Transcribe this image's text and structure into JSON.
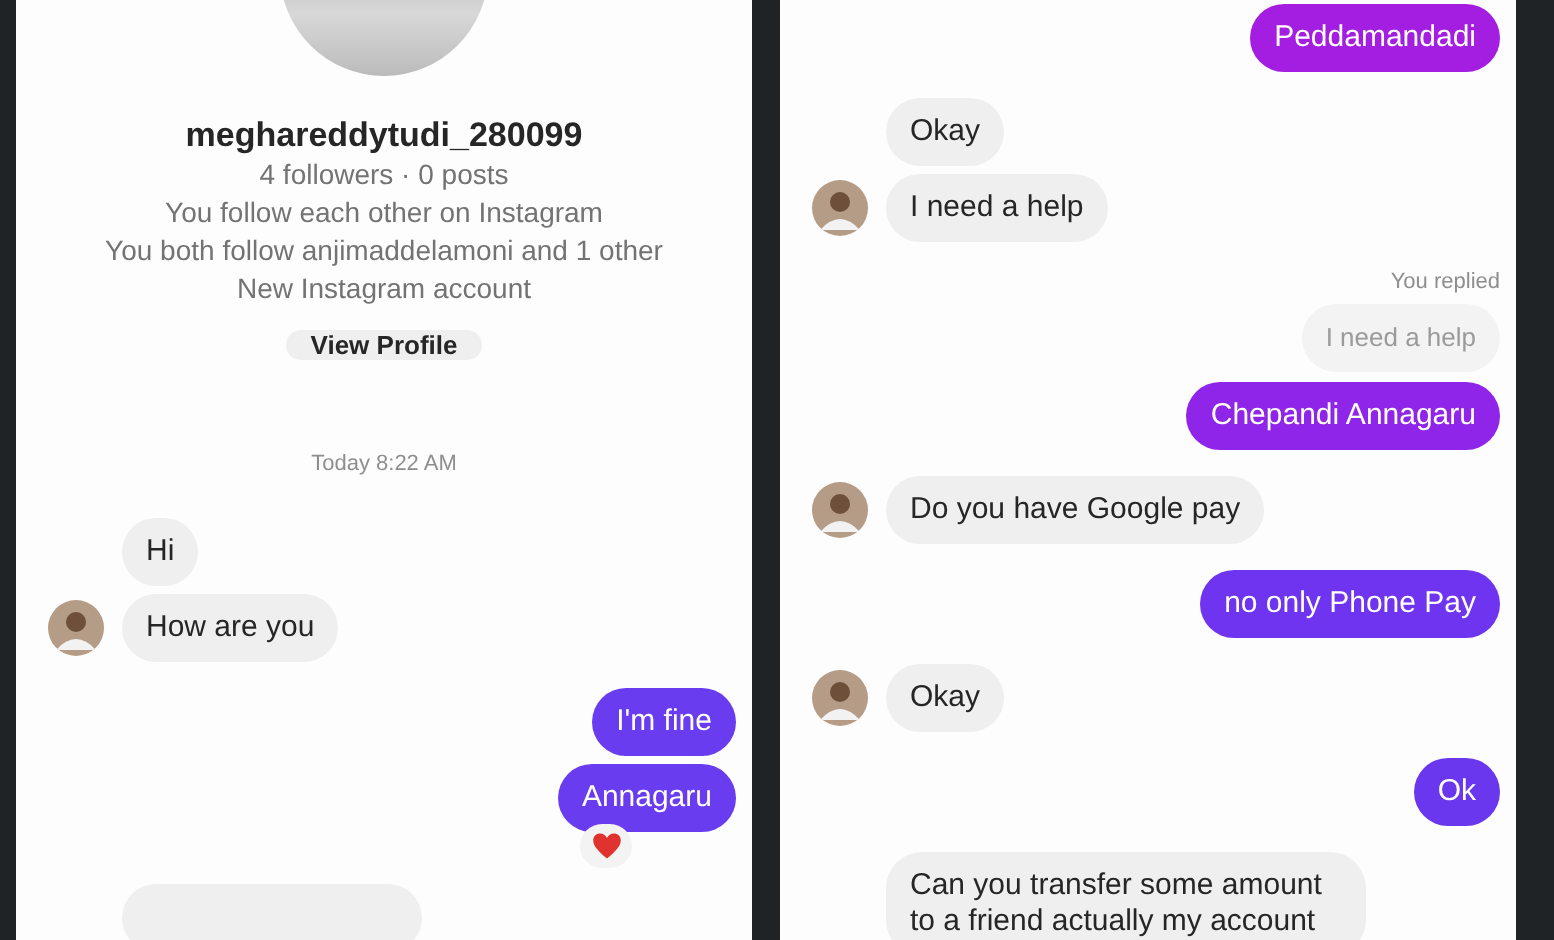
{
  "left_panel": {
    "profile": {
      "username": "meghareddytudi_280099",
      "stats": "4 followers · 0 posts",
      "mutual": "You follow each other on Instagram",
      "mutual_follows": "You both follow anjimaddelamoni and 1 other",
      "account_note": "New Instagram account",
      "button": "View Profile"
    },
    "timestamp": "Today 8:22 AM",
    "messages": [
      {
        "kind": "received",
        "text": "Hi",
        "avatar": false
      },
      {
        "kind": "received",
        "text": "How are you",
        "avatar": true
      },
      {
        "kind": "sent",
        "text": "I'm fine",
        "color": "#6a3cf0"
      },
      {
        "kind": "sent",
        "text": "Annagaru",
        "color": "#6a3cf0",
        "reaction": true
      },
      {
        "kind": "clipped"
      }
    ]
  },
  "right_panel": {
    "messages": [
      {
        "kind": "sent",
        "text": "Peddamandadi",
        "color": "#a31ee0"
      },
      {
        "kind": "received",
        "text": "Okay",
        "avatar": false
      },
      {
        "kind": "received",
        "text": "I need a help",
        "avatar": true
      },
      {
        "kind": "reply_quote",
        "label": "You replied",
        "text": "I need a help"
      },
      {
        "kind": "sent",
        "text": "Chepandi Annagaru",
        "color": "#8f25e8"
      },
      {
        "kind": "received",
        "text": "Do you have Google pay",
        "avatar": true
      },
      {
        "kind": "sent",
        "text": "no only Phone Pay",
        "color": "#6e34ef"
      },
      {
        "kind": "received",
        "text": "Okay",
        "avatar": true
      },
      {
        "kind": "sent",
        "text": "Ok",
        "color": "#6a36ee"
      },
      {
        "kind": "received",
        "text": "Can you transfer some amount to a friend actually my account",
        "avatar": false
      }
    ]
  }
}
